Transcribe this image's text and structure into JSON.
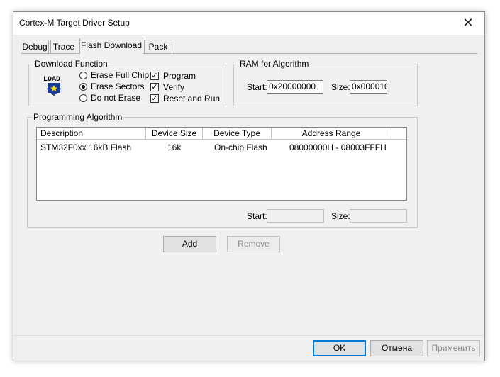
{
  "window": {
    "title": "Cortex-M Target Driver Setup",
    "close_glyph": "✕"
  },
  "tabs": [
    {
      "label": "Debug",
      "active": false
    },
    {
      "label": "Trace",
      "active": false
    },
    {
      "label": "Flash Download",
      "active": true
    },
    {
      "label": "Pack",
      "active": false
    }
  ],
  "download_function": {
    "title": "Download Function",
    "icon_text": "LOAD",
    "radios": [
      {
        "label": "Erase Full Chip",
        "checked": false
      },
      {
        "label": "Erase Sectors",
        "checked": true
      },
      {
        "label": "Do not Erase",
        "checked": false
      }
    ],
    "checks": [
      {
        "label": "Program",
        "checked": true
      },
      {
        "label": "Verify",
        "checked": true
      },
      {
        "label": "Reset and Run",
        "checked": true
      }
    ]
  },
  "ram": {
    "title": "RAM for Algorithm",
    "start_label": "Start:",
    "start_value": "0x20000000",
    "size_label": "Size:",
    "size_value": "0x000010"
  },
  "programming": {
    "title": "Programming Algorithm",
    "columns": [
      "Description",
      "Device Size",
      "Device Type",
      "Address Range"
    ],
    "rows": [
      [
        "STM32F0xx 16kB Flash",
        "16k",
        "On-chip Flash",
        "08000000H - 08003FFFH"
      ]
    ],
    "start_label": "Start:",
    "start_value": "",
    "size_label": "Size:",
    "size_value": ""
  },
  "actions": {
    "add": "Add",
    "remove": "Remove"
  },
  "footer": {
    "ok": "OK",
    "cancel": "Отмена",
    "apply": "Применить"
  },
  "colors": {
    "accent": "#0078d7",
    "icon_blue": "#1a3fa0",
    "icon_yellow": "#ffe400"
  }
}
